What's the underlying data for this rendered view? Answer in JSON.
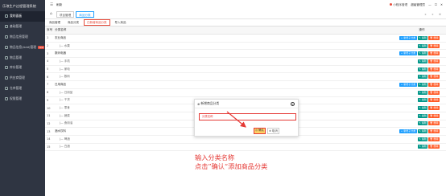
{
  "sidebar": {
    "app_title": "乐琅生产过程管理系统",
    "items": [
      {
        "label": "我的面板",
        "active": true
      },
      {
        "label": "基础管理"
      },
      {
        "label": "物品信息管理"
      },
      {
        "label": "物品信息(Add)管理",
        "badge": "new"
      },
      {
        "label": "物品管理"
      },
      {
        "label": "库存管理"
      },
      {
        "label": "供应商管理"
      },
      {
        "label": "仓库管理"
      },
      {
        "label": "权限管理"
      }
    ]
  },
  "topbar": {
    "collapse_icon": "☰",
    "refresh_label": "刷新",
    "login_record": "小程序管理",
    "user": "超级管理员"
  },
  "tabs": {
    "home_icon": "⌂",
    "items": [
      {
        "label": "项目管理"
      },
      {
        "label": "商品分类",
        "active": true
      }
    ],
    "ctrl": [
      "«",
      "»",
      "✕"
    ]
  },
  "subtabs": [
    {
      "label": "商品管理"
    },
    {
      "label": "商品分类"
    },
    {
      "label": "已新增商品分类",
      "active": true
    },
    {
      "label": "导入商品"
    }
  ],
  "table": {
    "header": {
      "no": "序号",
      "name": "分类名称",
      "ops": "操作"
    },
    "ops_labels": {
      "add": "+ 新增子分类",
      "edit": "✎ 编辑",
      "delete": "🗑 删除"
    },
    "rows": [
      {
        "no": "1",
        "name": "农业商品",
        "child": false,
        "add": true
      },
      {
        "no": "2",
        "name": "|— 水果",
        "child": true,
        "add": false
      },
      {
        "no": "3",
        "name": "数码电器",
        "child": false,
        "add": true
      },
      {
        "no": "4",
        "name": "|— 手机",
        "child": true,
        "add": false
      },
      {
        "no": "5",
        "name": "|— 家电",
        "child": true,
        "add": false
      },
      {
        "no": "6",
        "name": "|— 数码",
        "child": true,
        "add": false
      },
      {
        "no": "7",
        "name": "日用商品",
        "child": false,
        "add": true
      },
      {
        "no": "8",
        "name": "|— 日用品",
        "child": true,
        "add": false
      },
      {
        "no": "9",
        "name": "|— 干货",
        "child": true,
        "add": false
      },
      {
        "no": "10",
        "name": "|— 零食",
        "child": true,
        "add": false
      },
      {
        "no": "11",
        "name": "|— 蔬菜",
        "child": true,
        "add": false
      },
      {
        "no": "12",
        "name": "|— 食用油",
        "child": true,
        "add": false
      },
      {
        "no": "13",
        "name": "酒水饮料",
        "child": false,
        "add": true
      },
      {
        "no": "14",
        "name": "|— 啤酒",
        "child": true,
        "add": false
      },
      {
        "no": "15",
        "name": "|— 白酒",
        "child": true,
        "add": false
      }
    ]
  },
  "modal": {
    "title": "新增商品分类",
    "input_placeholder": "分类名称",
    "ok_label": "◎ 确认",
    "cancel_label": "⊗ 取消"
  },
  "annotation": {
    "line1": "输入分类名称",
    "line2": "点击”确认“添加商品分类"
  }
}
